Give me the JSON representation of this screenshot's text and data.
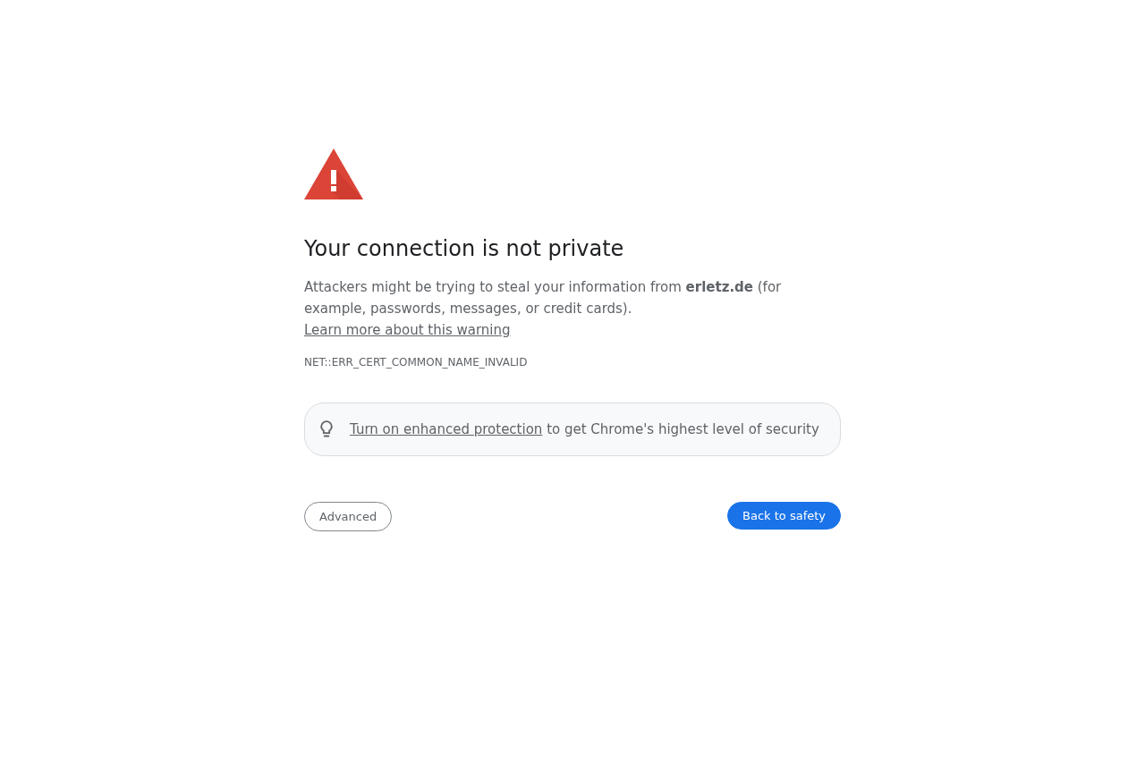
{
  "heading": "Your connection is not private",
  "message": {
    "text": "Attackers might be trying to steal your information from **erletz.de** (for example, passwords, messages, or credit cards).",
    "link": "Learn more about this warning"
  },
  "error_code": "NET::ERR_CERT_COMMON_NAME_INVALID",
  "promo": {
    "link": "Turn on enhanced protection",
    "text": "to get Chrome's highest level of security"
  },
  "buttons": [
    {
      "label": "Advanced",
      "kind": "secondary"
    },
    {
      "label": "Back to safety",
      "kind": "primary"
    }
  ]
}
